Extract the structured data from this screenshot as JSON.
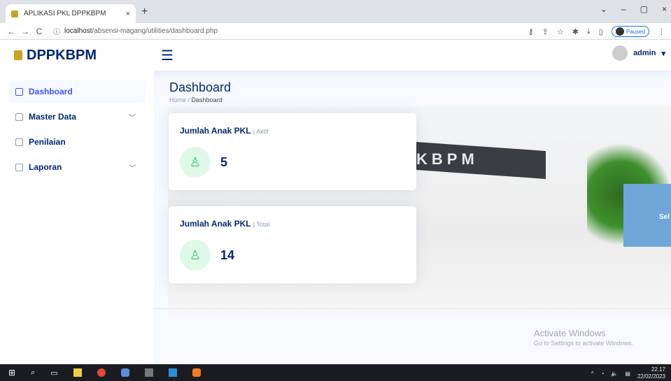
{
  "browser": {
    "tab_title": "APLIKASI PKL DPPKBPM",
    "tab_close": "×",
    "new_tab": "+",
    "url_host": "localhost",
    "url_path": "/absensi-magang/utilities/dashboard.php",
    "profile_status": "Paused",
    "window_controls": [
      "⌄",
      "–",
      "▢",
      "×"
    ]
  },
  "header": {
    "brand": "DPPKBPM",
    "menu_icon": "☰",
    "user": "admin"
  },
  "sidebar": {
    "items": [
      {
        "label": "Dashboard",
        "active": true,
        "icon": "grid-icon"
      },
      {
        "label": "Master Data",
        "icon": "database-icon",
        "chevron": true
      },
      {
        "label": "Penilaian",
        "icon": "document-icon"
      },
      {
        "label": "Laporan",
        "icon": "table-icon",
        "chevron": true
      }
    ]
  },
  "page": {
    "title": "Dashboard",
    "breadcrumb_home": "Home",
    "breadcrumb_sep": " / ",
    "breadcrumb_current": "Dashboard"
  },
  "hero": {
    "gate_text": "KBPM",
    "billboard_text": "Sel"
  },
  "cards": [
    {
      "title": "Jumlah Anak PKL",
      "sub": "| Aktif",
      "value": "5"
    },
    {
      "title": "Jumlah Anak PKL",
      "sub": "| Total",
      "value": "14"
    }
  ],
  "watermark": {
    "line1": "Activate Windows",
    "line2": "Go to Settings to activate Windows."
  },
  "taskbar": {
    "time": "22.17",
    "date": "22/02/2023"
  },
  "colors": {
    "brand": "#012970",
    "accent": "#4154f1",
    "success": "#2eca6a"
  }
}
